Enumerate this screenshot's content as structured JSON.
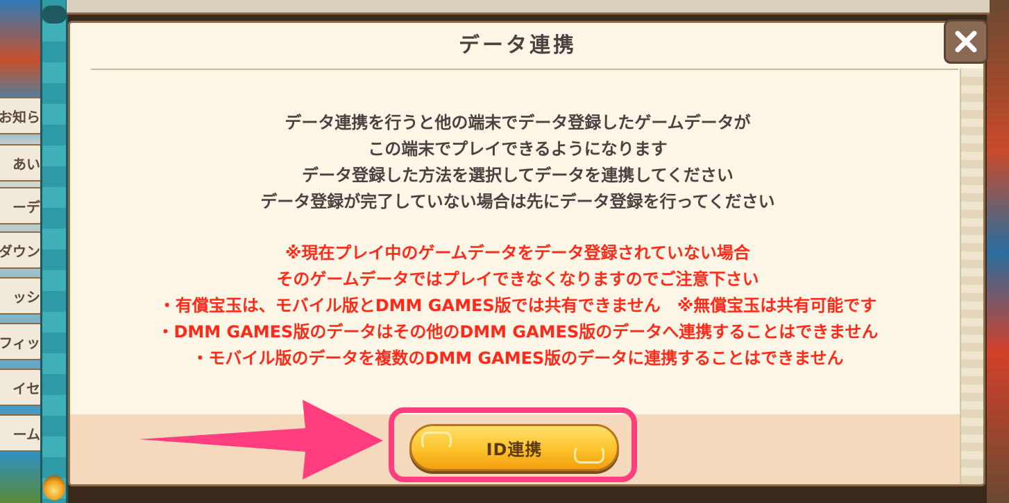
{
  "side_menu": {
    "tabs": [
      "お知ら",
      "あい",
      "ーデ",
      "ダウン",
      "ッシ",
      "フィッ",
      "イセ",
      "ーム"
    ]
  },
  "dialog": {
    "title": "データ連携",
    "close_icon": "close-icon",
    "info_lines": [
      "データ連携を行うと他の端末でデータ登録したゲームデータが",
      "この端末でプレイできるようになります",
      "データ登録した方法を選択してデータを連携してください",
      "データ登録が完了していない場合は先にデータ登録を行ってください"
    ],
    "warning_lines": [
      "※現在プレイ中のゲームデータをデータ登録されていない場合",
      "そのゲームデータではプレイできなくなりますのでご注意下さい",
      "・有償宝玉は、モバイル版とDMM GAMES版では共有できません　※無償宝玉は共有可能です",
      "・DMM GAMES版のデータはその他のDMM GAMES版のデータへ連携することはできません",
      "・モバイル版のデータを複数のDMM GAMES版のデータに連携することはできません"
    ],
    "id_button_label": "ID連携"
  },
  "colors": {
    "info_text": "#4a4240",
    "warning_text": "#ff2a1a",
    "highlight": "#ff3d7f",
    "button_gold": "#fcc22a"
  }
}
